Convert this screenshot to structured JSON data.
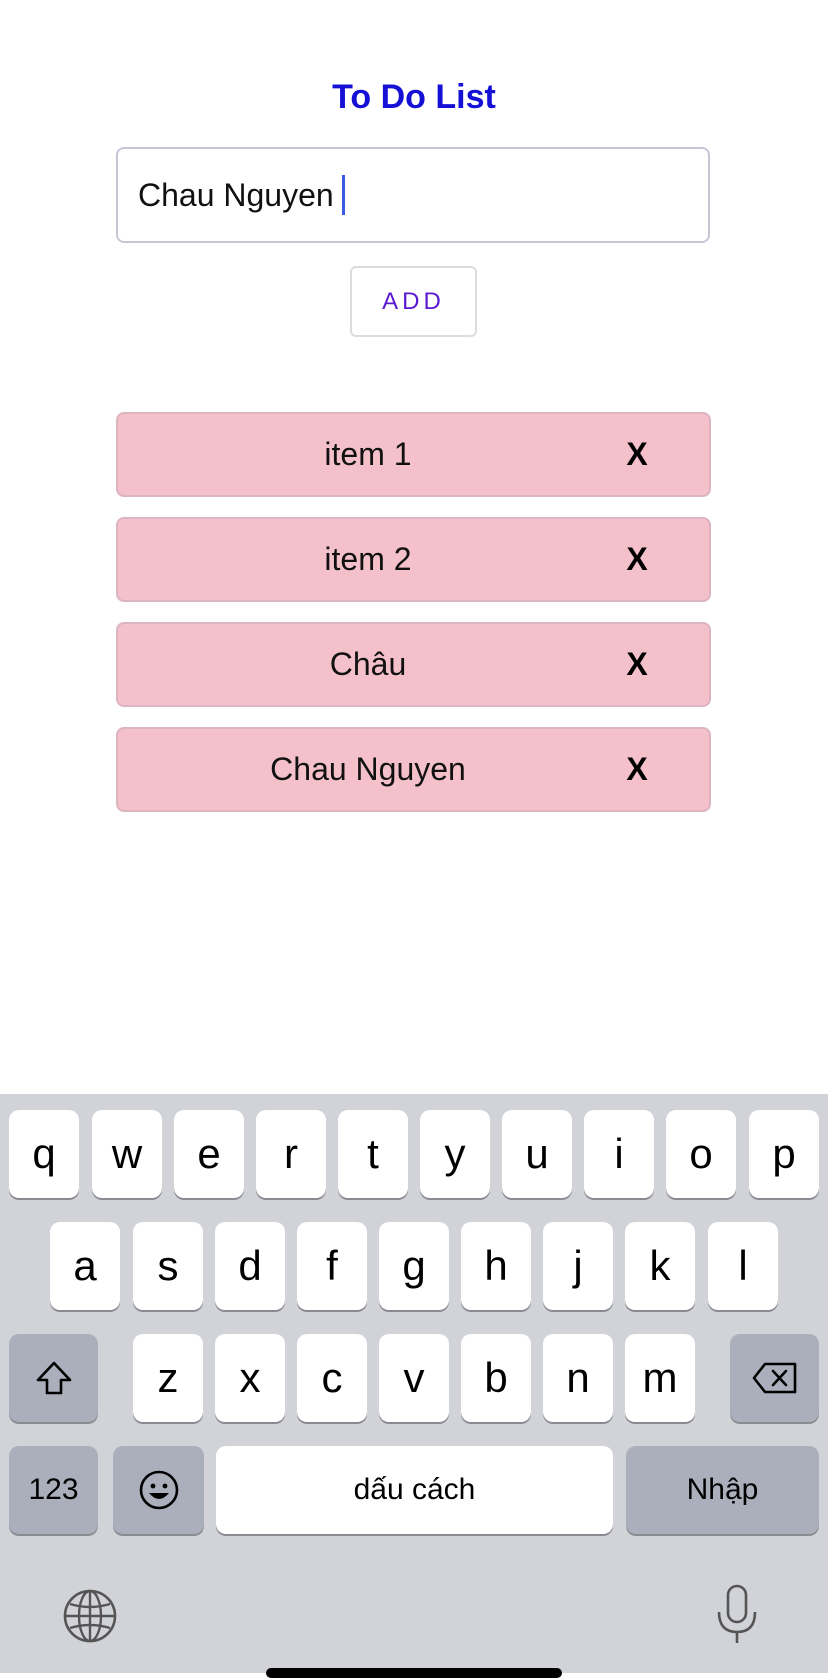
{
  "app": {
    "title": "To Do List",
    "input_value": "Chau Nguyen",
    "add_label": "ADD",
    "remove_label": "X",
    "items": [
      "item 1",
      "item 2",
      "Châu",
      "Chau Nguyen"
    ]
  },
  "keyboard": {
    "row1": [
      "q",
      "w",
      "e",
      "r",
      "t",
      "y",
      "u",
      "i",
      "o",
      "p"
    ],
    "row2": [
      "a",
      "s",
      "d",
      "f",
      "g",
      "h",
      "j",
      "k",
      "l"
    ],
    "row3": [
      "z",
      "x",
      "c",
      "v",
      "b",
      "n",
      "m"
    ],
    "numbers_label": "123",
    "space_label": "dấu cách",
    "return_label": "Nhập",
    "icons": [
      "shift-icon",
      "backspace-icon",
      "emoji-icon",
      "globe-icon",
      "microphone-icon"
    ]
  },
  "colors": {
    "title": "#1510d6",
    "add_text": "#5a18d0",
    "item_bg": "#f4c1cb",
    "caret": "#3d5be0"
  }
}
